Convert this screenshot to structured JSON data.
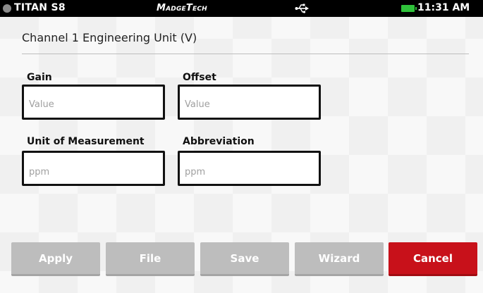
{
  "status_bar": {
    "device_name": "TITAN S8",
    "brand": "MadgeTech",
    "time": "11:31 AM",
    "battery_color": "#2fc23a",
    "usb_icon": "usb-icon"
  },
  "page": {
    "title": "Channel 1 Engineering Unit (V)"
  },
  "fields": {
    "gain": {
      "label": "Gain",
      "placeholder": "Value",
      "value": ""
    },
    "offset": {
      "label": "Offset",
      "placeholder": "Value",
      "value": ""
    },
    "unit": {
      "label": "Unit of Measurement",
      "placeholder": "ppm",
      "value": ""
    },
    "abbreviation": {
      "label": "Abbreviation",
      "placeholder": "ppm",
      "value": ""
    }
  },
  "buttons": {
    "apply": "Apply",
    "file": "File",
    "save": "Save",
    "wizard": "Wizard",
    "cancel": "Cancel"
  },
  "colors": {
    "status_bar_bg": "#000000",
    "button_disabled": "#bdbdbd",
    "button_cancel": "#c8111a"
  }
}
